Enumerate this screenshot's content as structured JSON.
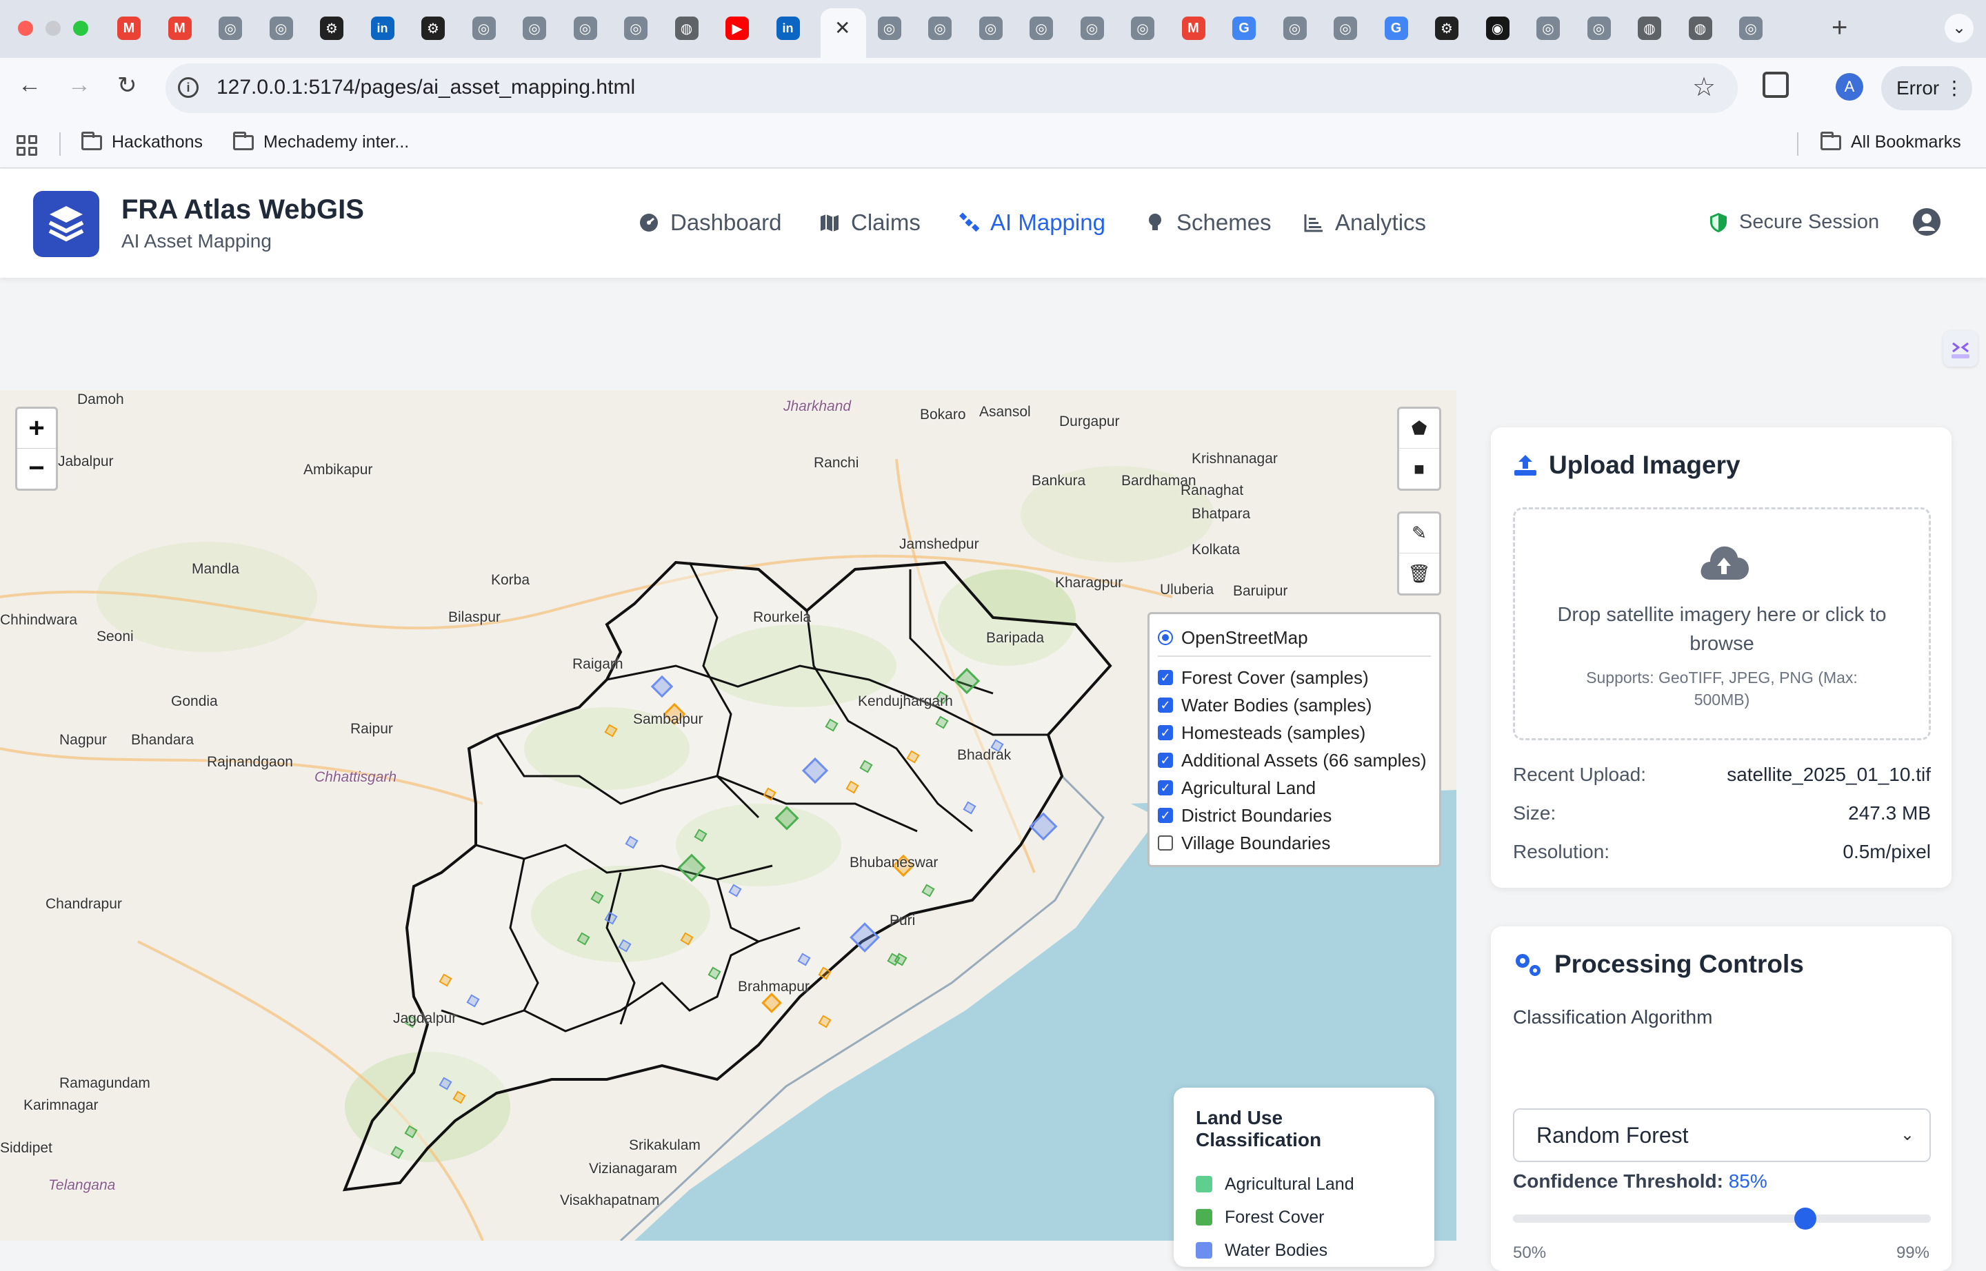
{
  "browser": {
    "url": "127.0.0.1:5174/pages/ai_asset_mapping.html",
    "error_label": "Error",
    "profile_initial": "A",
    "bookmarks": [
      "Hackathons",
      "Mechademy inter..."
    ],
    "all_bookmarks": "All Bookmarks",
    "tab_favicons": [
      "gmail-icon",
      "gmail-icon",
      "app-icon",
      "app-icon",
      "openai-icon",
      "linkedin-icon",
      "openai-icon",
      "app-icon",
      "app-icon",
      "app-icon",
      "app-icon",
      "globe-icon",
      "youtube-icon",
      "linkedin-icon",
      "active-tab",
      "app-icon",
      "app-icon",
      "app-icon",
      "app-icon",
      "app-icon",
      "app-icon",
      "gmail-icon",
      "google-icon",
      "app-icon",
      "app-icon",
      "google-icon",
      "openai-icon",
      "github-icon",
      "app-icon",
      "app-icon",
      "globe-icon",
      "globe-icon",
      "app-icon"
    ]
  },
  "header": {
    "title": "FRA Atlas WebGIS",
    "subtitle": "AI Asset Mapping",
    "nav": [
      {
        "label": "Dashboard",
        "icon": "dashboard-icon",
        "active": false
      },
      {
        "label": "Claims",
        "icon": "map-icon",
        "active": false
      },
      {
        "label": "AI Mapping",
        "icon": "satellite-icon",
        "active": true
      },
      {
        "label": "Schemes",
        "icon": "lightbulb-icon",
        "active": false
      },
      {
        "label": "Analytics",
        "icon": "chart-icon",
        "active": false
      }
    ],
    "secure_session": "Secure Session",
    "colors": {
      "accent": "#2563eb",
      "brand": "#2e4dbf",
      "secure": "#16a34a"
    }
  },
  "map": {
    "zoom_in": "+",
    "zoom_out": "−",
    "place_labels": [
      "Damoh",
      "Jharkhand",
      "Bokaro",
      "Asansol",
      "Durgapur",
      "Jabalpur",
      "Ambikapur",
      "Ranchi",
      "Krishnanagar",
      "Bankura",
      "Bardhaman",
      "Ranaghat",
      "Bhatpara",
      "Jamshedpur",
      "Kolkata",
      "Mandla",
      "Korba",
      "Kharagpur",
      "Uluberia",
      "Baruipur",
      "Chhindwara",
      "Seoni",
      "Bilaspur",
      "Rourkela",
      "Raigarh",
      "Baripada",
      "Gondia",
      "Raipur",
      "Sambalpur",
      "Kendujhargarh",
      "Nagpur",
      "Bhandara",
      "Rajnandgaon",
      "Chhattisgarh",
      "Bhadrak",
      "Chandrapur",
      "Bhubaneswar",
      "Puri",
      "Jagdalpur",
      "Brahmapur",
      "Ramagundam",
      "Karimnagar",
      "Siddipet",
      "Telangana",
      "Srikakulam",
      "Vizianagaram",
      "Visakhapatnam"
    ],
    "layers": {
      "base": "OpenStreetMap",
      "overlays": [
        {
          "label": "Forest Cover (samples)",
          "checked": true
        },
        {
          "label": "Water Bodies (samples)",
          "checked": true
        },
        {
          "label": "Homesteads (samples)",
          "checked": true
        },
        {
          "label": "Additional Assets (66 samples)",
          "checked": true
        },
        {
          "label": "Agricultural Land",
          "checked": true
        },
        {
          "label": "District Boundaries",
          "checked": true
        },
        {
          "label": "Village Boundaries",
          "checked": false
        }
      ]
    },
    "legend": {
      "title": "Land Use Classification",
      "items": [
        {
          "label": "Agricultural Land",
          "color": "#5ecf8f"
        },
        {
          "label": "Forest Cover",
          "color": "#4caf50"
        },
        {
          "label": "Water Bodies",
          "color": "#6b8ef0"
        }
      ]
    },
    "colors": {
      "land": "#f2efe9",
      "sea": "#aad3df",
      "forest": "#cfe3b5",
      "boundary": "#111111",
      "homestead": "#f59e0b"
    }
  },
  "upload": {
    "title": "Upload Imagery",
    "drop_text": "Drop satellite imagery here or click to browse",
    "supports": "Supports: GeoTIFF, JPEG, PNG (Max: 500MB)",
    "recent_label": "Recent Upload:",
    "recent_value": "satellite_2025_01_10.tif",
    "size_label": "Size:",
    "size_value": "247.3 MB",
    "resolution_label": "Resolution:",
    "resolution_value": "0.5m/pixel"
  },
  "processing": {
    "title": "Processing Controls",
    "algorithm_label": "Classification Algorithm",
    "algorithm_value": "Random Forest",
    "confidence_label": "Confidence Threshold:",
    "confidence_value": "85%",
    "confidence_fraction": 0.7,
    "min_label": "50%",
    "max_label": "99%"
  }
}
